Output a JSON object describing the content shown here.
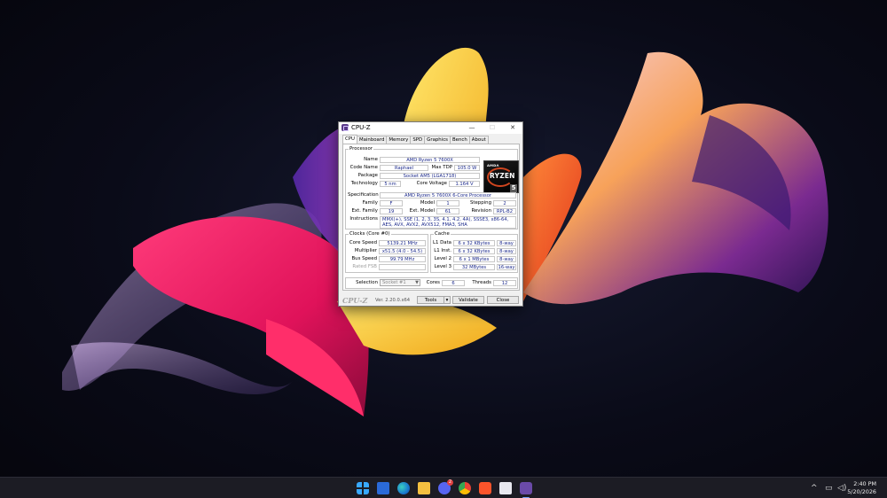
{
  "window": {
    "title": "CPU-Z",
    "min_glyph": "—",
    "max_glyph": "☐",
    "close_glyph": "✕",
    "tabs": [
      "CPU",
      "Mainboard",
      "Memory",
      "SPD",
      "Graphics",
      "Bench",
      "About"
    ],
    "active_tab": "CPU"
  },
  "processor": {
    "group_title": "Processor",
    "name_label": "Name",
    "name": "AMD Ryzen 5 7600X",
    "codename_label": "Code Name",
    "codename": "Raphael",
    "maxtdp_label": "Max TDP",
    "maxtdp": "105.0 W",
    "package_label": "Package",
    "package": "Socket AM5 (LGA1718)",
    "technology_label": "Technology",
    "technology": "5 nm",
    "corevoltage_label": "Core Voltage",
    "corevoltage": "1.164 V",
    "spec_label": "Specification",
    "spec": "AMD Ryzen 5 7600X 6-Core Processor",
    "family_label": "Family",
    "family": "F",
    "model_label": "Model",
    "model": "1",
    "stepping_label": "Stepping",
    "stepping": "2",
    "extfamily_label": "Ext. Family",
    "extfamily": "19",
    "extmodel_label": "Ext. Model",
    "extmodel": "61",
    "revision_label": "Revision",
    "revision": "RPL-B2",
    "instructions_label": "Instructions",
    "instructions": "MMX(+), SSE (1, 2, 3, 3S, 4.1, 4.2, 4A), SSSE3, x86-64, AES, AVX, AVX2, AVX512, FMA3, SHA",
    "logo": {
      "brand": "AMDΛ",
      "series": "RYZEN",
      "tier": "5"
    }
  },
  "clocks": {
    "group_title": "Clocks (Core #0)",
    "corespeed_label": "Core Speed",
    "corespeed": "5139.21 MHz",
    "multiplier_label": "Multiplier",
    "multiplier": "x51.5 (4.0 - 54.5)",
    "busspeed_label": "Bus Speed",
    "busspeed": "99.79 MHz",
    "ratedfsb_label": "Rated FSB",
    "ratedfsb": ""
  },
  "cache": {
    "group_title": "Cache",
    "rows": [
      {
        "label": "L1 Data",
        "size": "6 x 32 KBytes",
        "ways": "8-way"
      },
      {
        "label": "L1 Inst.",
        "size": "6 x 32 KBytes",
        "ways": "8-way"
      },
      {
        "label": "Level 2",
        "size": "6 x 1 MBytes",
        "ways": "8-way"
      },
      {
        "label": "Level 3",
        "size": "32 MBytes",
        "ways": "16-way"
      }
    ]
  },
  "selection": {
    "label": "Selection",
    "value": "Socket #1",
    "cores_label": "Cores",
    "cores": "6",
    "threads_label": "Threads",
    "threads": "12"
  },
  "footer": {
    "brand": "CPU-Z",
    "version": "Ver. 2.20.0.x64",
    "tools": "Tools",
    "validate": "Validate",
    "close": "Close"
  },
  "taskbar": {
    "icons": [
      "windows-start-icon",
      "store-icon",
      "edge-icon",
      "file-explorer-icon",
      "discord-icon",
      "chrome-icon",
      "brave-icon",
      "snipping-tool-icon",
      "cpuz-taskbar-icon"
    ],
    "discord_badge": "2",
    "time": "2:40 PM",
    "date": "5/20/2026"
  },
  "colors": {
    "value_text": "#1c2a8c",
    "taskbar": "#1c1c24",
    "accent": "#7aa4ff"
  }
}
